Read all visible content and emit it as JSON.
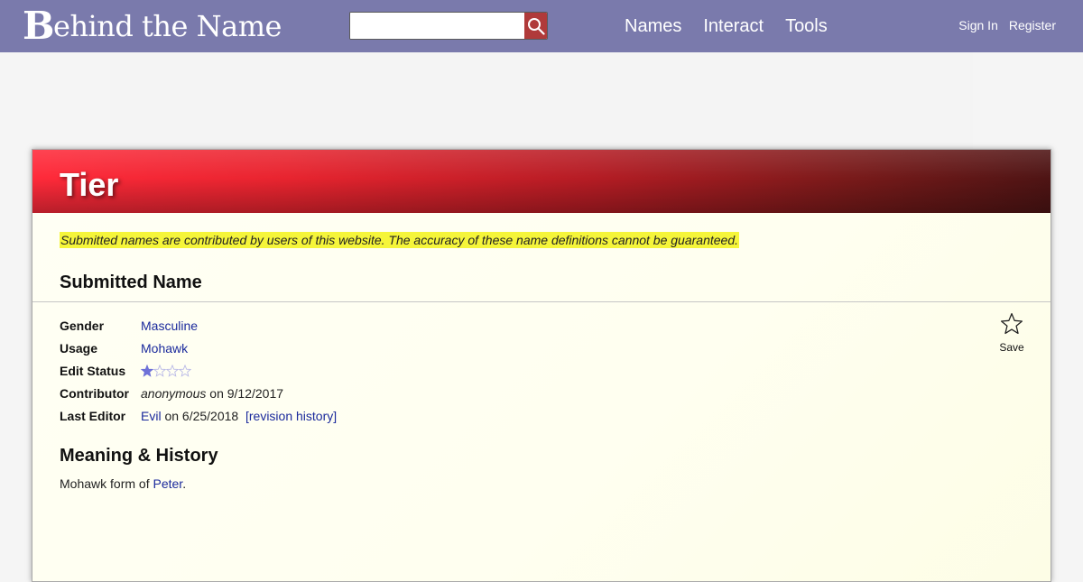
{
  "header": {
    "logo_cap": "B",
    "logo_rest": "ehind the Name",
    "search_value": "",
    "nav": [
      "Names",
      "Interact",
      "Tools"
    ],
    "sign_in": "Sign In",
    "register": "Register"
  },
  "name": {
    "title": "Tier",
    "disclaimer": "Submitted names are contributed by users of this website. The accuracy of these name definitions cannot be guaranteed.",
    "section_title": "Submitted Name",
    "fields": {
      "gender_label": "Gender",
      "gender_value": "Masculine",
      "usage_label": "Usage",
      "usage_value": "Mohawk",
      "edit_status_label": "Edit Status",
      "edit_status_stars": 1,
      "edit_status_max": 4,
      "contributor_label": "Contributor",
      "contributor_name": "anonymous",
      "contributor_on": "on 9/12/2017",
      "last_editor_label": "Last Editor",
      "last_editor_name": "Evil",
      "last_editor_on": "on 6/25/2018",
      "revision_history": "[revision history]"
    },
    "save_label": "Save",
    "meaning_title": "Meaning & History",
    "meaning_prefix": "Mohawk form of ",
    "meaning_link": "Peter",
    "meaning_suffix": "."
  },
  "colors": {
    "header_bg": "#7a7aac",
    "link": "#1b2a9c",
    "highlight": "#f5f53a",
    "search_button": "#b03a3a",
    "star_filled": "#6f72d8",
    "star_empty": "#b8b8e6"
  },
  "icons": {
    "search": "search-icon",
    "save": "star-outline-icon",
    "rating": "star-icon"
  }
}
